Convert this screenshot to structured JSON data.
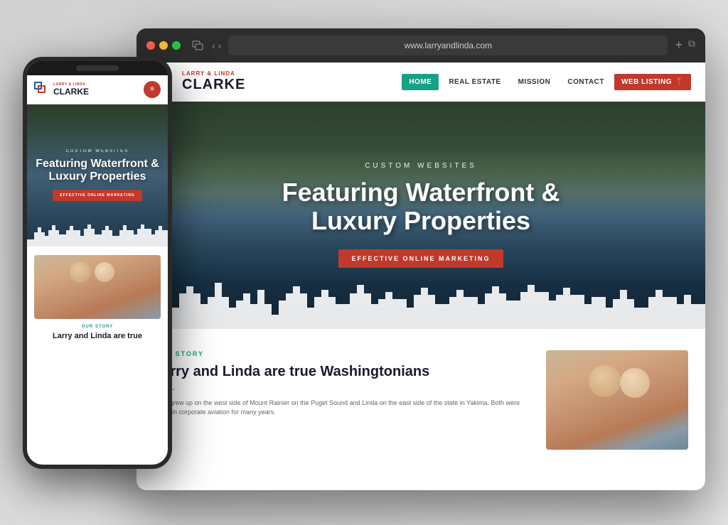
{
  "scene": {
    "background": "#e0e0e0"
  },
  "desktop": {
    "browser": {
      "url": "www.larryandlinda.com",
      "traffic_lights": [
        "red",
        "yellow",
        "green"
      ]
    },
    "site": {
      "logo": {
        "small_text": "LARRY & LINDA",
        "large_text": "CLARKE"
      },
      "nav": {
        "items": [
          {
            "label": "HOME",
            "active": true
          },
          {
            "label": "REAL ESTATE",
            "active": false
          },
          {
            "label": "MISSION",
            "active": false
          },
          {
            "label": "CONTACT",
            "active": false
          }
        ],
        "cta_button": "WEB LISTING"
      },
      "hero": {
        "subtitle": "CUSTOM WEBSITES",
        "title": "Featuring Waterfront & Luxury Properties",
        "cta": "EFFECTIVE ONLINE MARKETING"
      },
      "story": {
        "tag": "OUR STORY",
        "heading": "Larry and Linda are true Washingtonians",
        "body": "Larry grew up on the west side of Mount Rainier on the Puget Sound and Linda on the east side of the state in Yakima. Both were active in corporate aviation for many years."
      }
    }
  },
  "mobile": {
    "logo": {
      "small_text": "LARRY & LINDA",
      "large_text": "CLARKE"
    },
    "hero": {
      "subtitle": "CUSTOM WEBSITES",
      "title": "Featuring Waterfront & Luxury Properties",
      "cta": "EFFECTIVE ONLINE MARKETING"
    },
    "story": {
      "tag": "OUR STORY",
      "heading": "Larry and Linda are true"
    }
  }
}
